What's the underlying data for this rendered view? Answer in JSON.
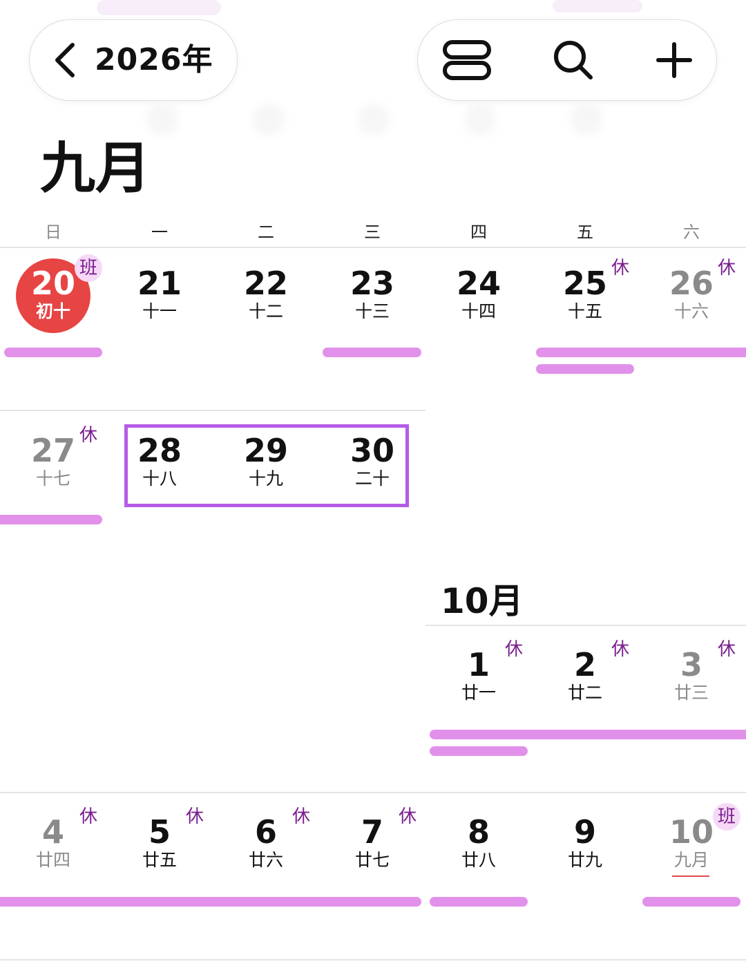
{
  "header": {
    "year_label": "2026年",
    "icons": [
      "chevron-left-icon",
      "view-toggle-icon",
      "search-icon",
      "plus-icon"
    ]
  },
  "colors": {
    "today": "#e74444",
    "event_bar": "#e291ea",
    "selection": "#b55ce6",
    "badge_text": "#7a1f8f",
    "badge_ban_bg": "#f6d9f6",
    "off_day_text": "#8a8a8a"
  },
  "calendar": {
    "month_title": "九月",
    "october_label": "10月",
    "weekdays": [
      "日",
      "一",
      "二",
      "三",
      "四",
      "五",
      "六"
    ],
    "days": {
      "sep20": {
        "num": "20",
        "lunar": "初十",
        "badge": "班"
      },
      "sep21": {
        "num": "21",
        "lunar": "十一"
      },
      "sep22": {
        "num": "22",
        "lunar": "十二"
      },
      "sep23": {
        "num": "23",
        "lunar": "十三"
      },
      "sep24": {
        "num": "24",
        "lunar": "十四"
      },
      "sep25": {
        "num": "25",
        "lunar": "十五",
        "badge": "休"
      },
      "sep26": {
        "num": "26",
        "lunar": "十六",
        "badge": "休"
      },
      "sep27": {
        "num": "27",
        "lunar": "十七",
        "badge": "休"
      },
      "sep28": {
        "num": "28",
        "lunar": "十八"
      },
      "sep29": {
        "num": "29",
        "lunar": "十九"
      },
      "sep30": {
        "num": "30",
        "lunar": "二十"
      },
      "oct1": {
        "num": "1",
        "lunar": "廿一",
        "badge": "休"
      },
      "oct2": {
        "num": "2",
        "lunar": "廿二",
        "badge": "休"
      },
      "oct3": {
        "num": "3",
        "lunar": "廿三",
        "badge": "休"
      },
      "oct4": {
        "num": "4",
        "lunar": "廿四",
        "badge": "休"
      },
      "oct5": {
        "num": "5",
        "lunar": "廿五",
        "badge": "休"
      },
      "oct6": {
        "num": "6",
        "lunar": "廿六",
        "badge": "休"
      },
      "oct7": {
        "num": "7",
        "lunar": "廿七",
        "badge": "休"
      },
      "oct8": {
        "num": "8",
        "lunar": "廿八"
      },
      "oct9": {
        "num": "9",
        "lunar": "廿九"
      },
      "oct10": {
        "num": "10",
        "lunar": "九月",
        "badge": "班"
      }
    }
  }
}
